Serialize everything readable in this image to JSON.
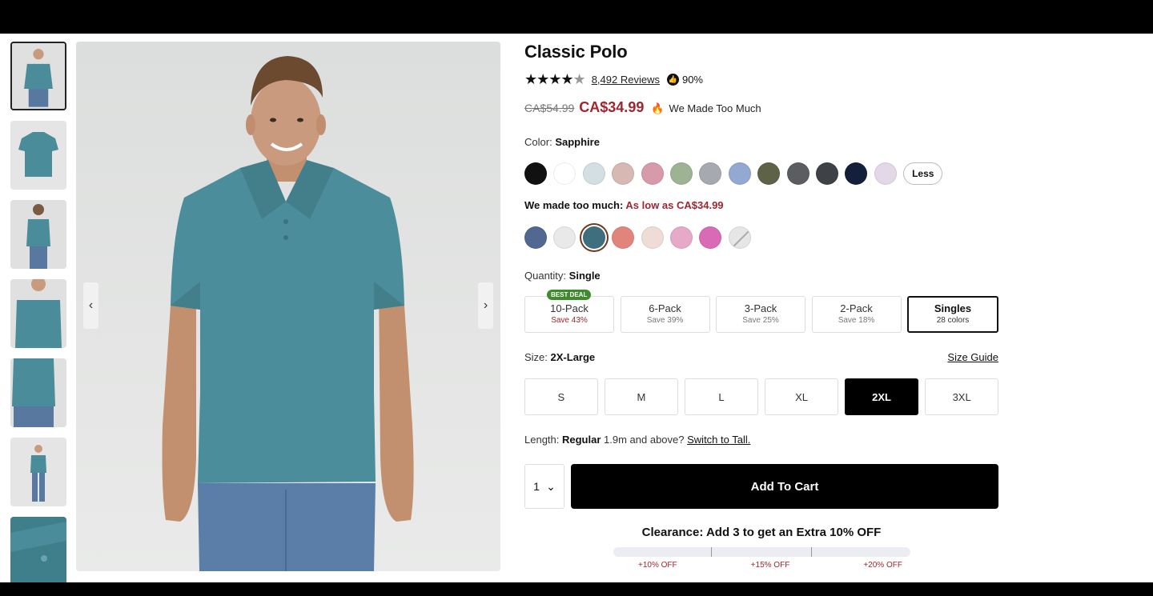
{
  "product": {
    "title": "Classic Polo",
    "reviews_count": "8,492 Reviews",
    "rating": 4.5,
    "recommend_pct": "90%",
    "old_price": "CA$54.99",
    "new_price": "CA$34.99",
    "promo_text": "We Made Too Much"
  },
  "color": {
    "label": "Color:",
    "selected": "Sapphire",
    "swatches": [
      "#111111",
      "#ffffff",
      "#d3dfe3",
      "#d7b8b2",
      "#d79aaa",
      "#9eb294",
      "#a7a9b0",
      "#93a9d2",
      "#5e6347",
      "#5b5d61",
      "#3e4145",
      "#14203b",
      "#e2d8e8"
    ],
    "less_label": "Less"
  },
  "sale": {
    "label": "We made too much:",
    "value": "As low as CA$34.99",
    "swatches": [
      "#536891",
      "#e9e9e9",
      "#3f6f7f",
      "#e1857c",
      "#efdcd6",
      "#e6a9c7",
      "#d96ab6"
    ]
  },
  "quantity": {
    "label": "Quantity:",
    "selected": "Single",
    "badge": "BEST DEAL",
    "packs": [
      {
        "name": "10-Pack",
        "save": "Save 43%"
      },
      {
        "name": "6-Pack",
        "save": "Save 39%"
      },
      {
        "name": "3-Pack",
        "save": "Save 25%"
      },
      {
        "name": "2-Pack",
        "save": "Save 18%"
      },
      {
        "name": "Singles",
        "save": "28 colors"
      }
    ]
  },
  "size": {
    "label": "Size:",
    "selected": "2X-Large",
    "guide": "Size Guide",
    "options": [
      "S",
      "M",
      "L",
      "XL",
      "2XL",
      "3XL"
    ]
  },
  "length": {
    "label": "Length:",
    "selected": "Regular",
    "hint": "1.9m and above?",
    "link": "Switch to Tall."
  },
  "cart": {
    "qty": "1",
    "button": "Add To Cart"
  },
  "clearance": {
    "text": "Clearance: Add 3 to get an Extra 10% OFF",
    "tiers": [
      "+10% OFF",
      "+15% OFF",
      "+20% OFF"
    ]
  },
  "nav": {
    "prev": "‹",
    "next": "›"
  }
}
